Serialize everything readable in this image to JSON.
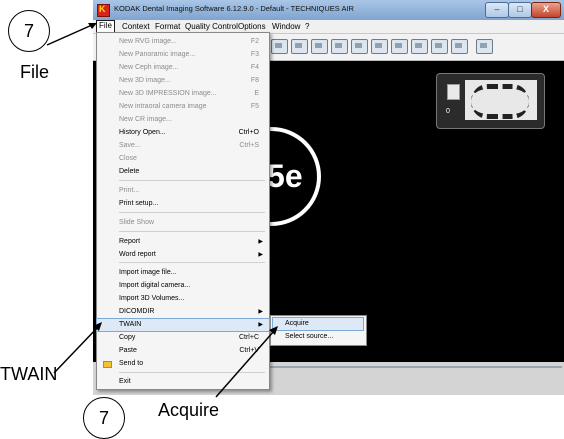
{
  "window": {
    "title": "KODAK Dental Imaging Software 6.12.9.0 - Default - TECHNIQUES AIR",
    "min_glyph": "–",
    "max_glyph": "□",
    "close_glyph": "X"
  },
  "menubar": [
    "File",
    "Context",
    "Format",
    "Quality Control",
    "Options",
    "Window",
    "?"
  ],
  "file_menu": [
    {
      "label": "New RVG image...",
      "shortcut": "F2",
      "enabled": false
    },
    {
      "label": "New Panoramic image...",
      "shortcut": "F3",
      "enabled": false
    },
    {
      "label": "New Ceph image...",
      "shortcut": "F4",
      "enabled": false
    },
    {
      "label": "New 3D image...",
      "shortcut": "F8",
      "enabled": false
    },
    {
      "label": "New 3D IMPRESSION image...",
      "shortcut": "E",
      "enabled": false
    },
    {
      "label": "New intraoral camera image",
      "shortcut": "F5",
      "enabled": false
    },
    {
      "label": "New CR image...",
      "shortcut": "",
      "enabled": false
    },
    {
      "label": "History Open...",
      "shortcut": "Ctrl+O",
      "enabled": true
    },
    {
      "label": "Save...",
      "shortcut": "Ctrl+S",
      "enabled": false
    },
    {
      "label": "Close",
      "shortcut": "",
      "enabled": false
    },
    {
      "label": "Delete",
      "shortcut": "",
      "enabled": true
    },
    {
      "label": "Print...",
      "shortcut": "",
      "enabled": false
    },
    {
      "label": "Print setup...",
      "shortcut": "",
      "enabled": true
    },
    {
      "label": "Slide Show",
      "shortcut": "",
      "enabled": false
    },
    {
      "label": "Report",
      "shortcut": "",
      "enabled": true,
      "submenu": true
    },
    {
      "label": "Word report",
      "shortcut": "",
      "enabled": true,
      "submenu": true
    },
    {
      "label": "Import image file...",
      "shortcut": "",
      "enabled": true
    },
    {
      "label": "Import digital camera...",
      "shortcut": "",
      "enabled": true
    },
    {
      "label": "Import 3D Volumes...",
      "shortcut": "",
      "enabled": true
    },
    {
      "label": "DICOMDIR",
      "shortcut": "",
      "enabled": true,
      "submenu": true
    },
    {
      "label": "TWAIN",
      "shortcut": "",
      "enabled": true,
      "submenu": true,
      "highlighted": true
    },
    {
      "label": "Copy",
      "shortcut": "Ctrl+C",
      "enabled": true
    },
    {
      "label": "Paste",
      "shortcut": "Ctrl+V",
      "enabled": true
    },
    {
      "label": "Send to",
      "shortcut": "",
      "enabled": true,
      "icon": "folder-icon"
    },
    {
      "label": "Exit",
      "shortcut": "",
      "enabled": true
    }
  ],
  "twain_submenu": [
    {
      "label": "Acquire",
      "highlighted": true
    },
    {
      "label": "Select source..."
    }
  ],
  "thumbnail": {
    "number": "0"
  },
  "version_badge": "4.5e",
  "callouts": {
    "step_top": "7",
    "step_bottom": "7",
    "file": "File",
    "twain": "TWAIN",
    "acquire": "Acquire"
  },
  "colors": {
    "highlight": "#dde9f6",
    "titlebar": "#a9c6e6",
    "app_icon": "#d9231d"
  }
}
